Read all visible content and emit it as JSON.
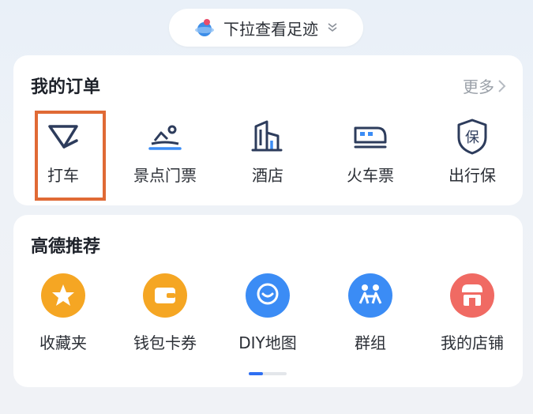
{
  "footprint": {
    "label": "下拉查看足迹"
  },
  "orders": {
    "title": "我的订单",
    "more": "更多",
    "items": [
      {
        "label": "打车",
        "icon": "taxi-icon"
      },
      {
        "label": "景点门票",
        "icon": "scenic-ticket-icon"
      },
      {
        "label": "酒店",
        "icon": "hotel-icon"
      },
      {
        "label": "火车票",
        "icon": "train-icon"
      },
      {
        "label": "出行保",
        "icon": "travel-insurance-icon"
      }
    ]
  },
  "recommend": {
    "title": "高德推荐",
    "items": [
      {
        "label": "收藏夹",
        "icon": "star-icon",
        "color": "#f5a623"
      },
      {
        "label": "钱包卡券",
        "icon": "wallet-icon",
        "color": "#f5a623"
      },
      {
        "label": "DIY地图",
        "icon": "map-pin-icon",
        "color": "#3b8cf5"
      },
      {
        "label": "群组",
        "icon": "group-icon",
        "color": "#3b8cf5"
      },
      {
        "label": "我的店铺",
        "icon": "shop-icon",
        "color": "#f06a63"
      }
    ],
    "pager": {
      "pages": 2,
      "active": 1
    }
  },
  "colors": {
    "highlight": "#e06a35",
    "accent": "#2e6ff2",
    "icon_stroke": "#2d3c5c"
  }
}
